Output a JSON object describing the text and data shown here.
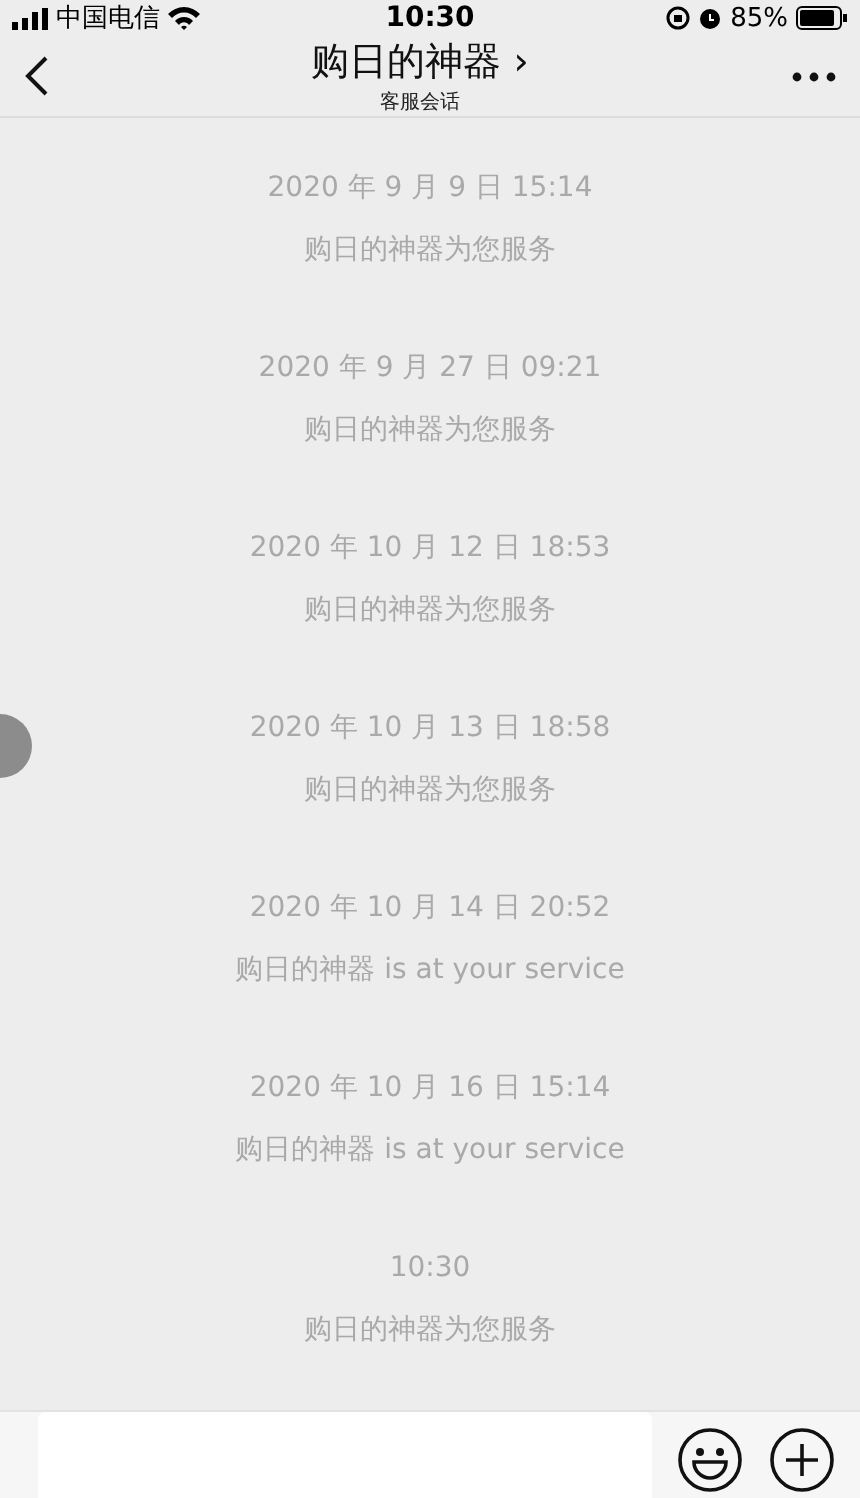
{
  "status_bar": {
    "carrier": "中国电信",
    "time": "10:30",
    "battery": "85%"
  },
  "nav": {
    "title": "购日的神器",
    "chevron": "›",
    "subtitle": "客服会话"
  },
  "messages": [
    {
      "time": "2020 年 9 月 9 日 15:14",
      "text": "购日的神器为您服务"
    },
    {
      "time": "2020 年 9 月 27 日 09:21",
      "text": "购日的神器为您服务"
    },
    {
      "time": "2020 年 10 月 12 日 18:53",
      "text": "购日的神器为您服务"
    },
    {
      "time": "2020 年 10 月 13 日 18:58",
      "text": "购日的神器为您服务"
    },
    {
      "time": "2020 年 10 月 14 日 20:52",
      "text": "购日的神器 is at your service"
    },
    {
      "time": "2020 年 10 月 16 日 15:14",
      "text": "购日的神器 is at your service"
    },
    {
      "time": "10:30",
      "text": "购日的神器为您服务"
    }
  ]
}
